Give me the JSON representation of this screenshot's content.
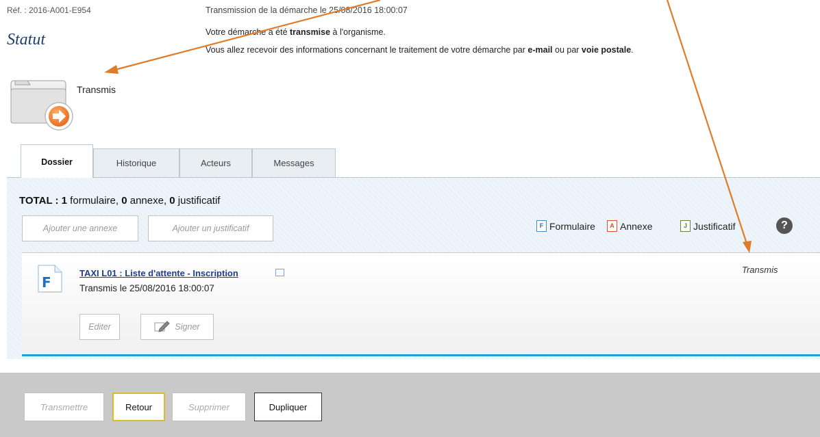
{
  "header": {
    "reference": "Réf. : 2016-A001-E954",
    "transmission_date": "Transmission de la démarche le 25/08/2016 18:00:07",
    "title": "Statut",
    "message_line1_pre": "Votre démarche a été ",
    "message_line1_bold": "transmise",
    "message_line1_post": " à l'organisme.",
    "message_line2_pre": "Vous allez recevoir des informations concernant le traitement de votre démarche par ",
    "message_line2_bold1": "e-mail",
    "message_line2_mid": " ou par ",
    "message_line2_bold2": "voie postale",
    "message_line2_post": "."
  },
  "status": {
    "label": "Transmis",
    "icon": "folder-transmit-icon",
    "accent": "#f07a2a"
  },
  "tabs": [
    {
      "label": "Dossier",
      "active": true
    },
    {
      "label": "Historique",
      "active": false
    },
    {
      "label": "Acteurs",
      "active": false
    },
    {
      "label": "Messages",
      "active": false
    }
  ],
  "total": {
    "prefix": "TOTAL : ",
    "formulaire_count": "1",
    "formulaire_label": " formulaire, ",
    "annexe_count": "0",
    "annexe_label": " annexe, ",
    "justificatif_count": "0",
    "justificatif_label": " justificatif"
  },
  "actions": {
    "add_annex": "Ajouter une annexe",
    "add_justificatif": "Ajouter un justificatif"
  },
  "legend": {
    "formulaire": {
      "letter": "F",
      "label": "Formulaire"
    },
    "annexe": {
      "letter": "A",
      "label": "Annexe"
    },
    "justificatif": {
      "letter": "J",
      "label": "Justificatif"
    },
    "help": "?"
  },
  "document": {
    "title": "TAXI L01 : Liste d'attente - Inscription",
    "status_text": "Transmis le 25/08/2016 18:00:07",
    "right_status": "Transmis",
    "edit_label": "Editer",
    "sign_label": "Signer",
    "icon_letter": "F"
  },
  "bottom_actions": {
    "transmettre": "Transmettre",
    "retour": "Retour",
    "supprimer": "Supprimer",
    "dupliquer": "Dupliquer"
  },
  "colors": {
    "annotation_arrow": "#e07b28",
    "panel_bg": "#e8f2f8",
    "accent_line": "#1aa3cf",
    "primary_border": "#e0b82b"
  }
}
